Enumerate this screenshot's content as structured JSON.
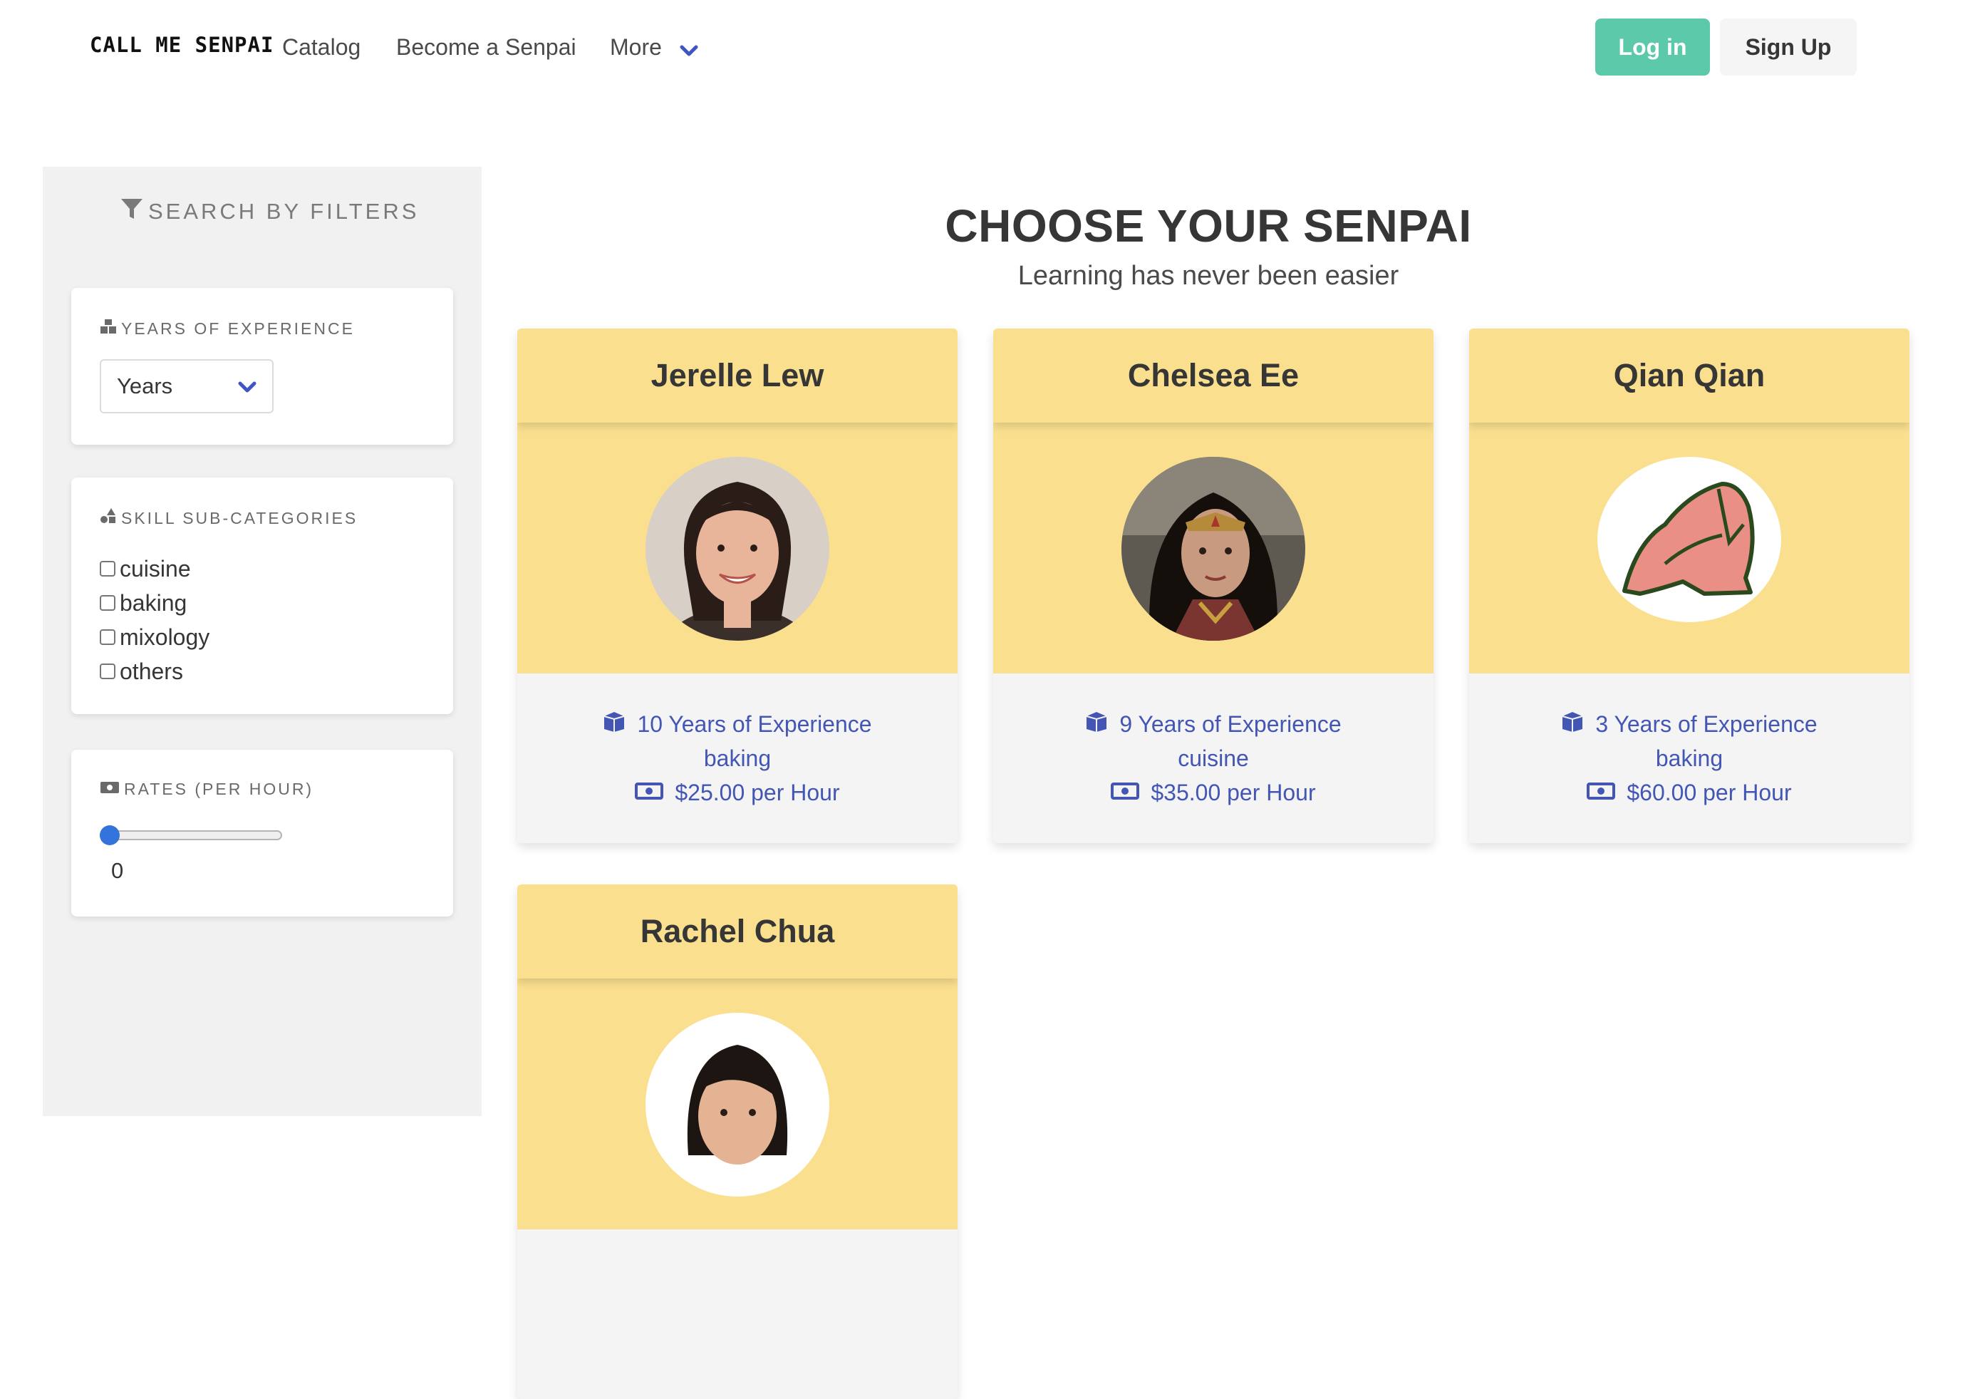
{
  "nav": {
    "brand": "CALL ME SENPAI",
    "links": [
      "Catalog",
      "Become a Senpai",
      "More"
    ],
    "login": "Log in",
    "signup": "Sign Up"
  },
  "sidebar": {
    "title": "SEARCH BY FILTERS",
    "experience": {
      "label": "YEARS OF EXPERIENCE",
      "select_value": "Years"
    },
    "skills": {
      "label": "SKILL SUB-CATEGORIES",
      "options": [
        "cuisine",
        "baking",
        "mixology",
        "others"
      ]
    },
    "rates": {
      "label": "RATES (PER HOUR)",
      "value": "0"
    }
  },
  "main": {
    "heading": "CHOOSE YOUR SENPAI",
    "subheading": "Learning has never been easier",
    "senpais": [
      {
        "name": "Jerelle Lew",
        "experience": "10 Years of Experience",
        "skill": "baking",
        "rate": "$25.00 per Hour"
      },
      {
        "name": "Chelsea Ee",
        "experience": "9 Years of Experience",
        "skill": "cuisine",
        "rate": "$35.00 per Hour"
      },
      {
        "name": "Qian Qian",
        "experience": "3 Years of Experience",
        "skill": "baking",
        "rate": "$60.00 per Hour"
      },
      {
        "name": "Rachel Chua"
      }
    ]
  },
  "colors": {
    "accent": "#5ccaaa",
    "card_header": "#f9df8e",
    "link": "#4456b4",
    "slider": "#3273dc"
  },
  "icons": [
    "filter-icon",
    "cubes-icon",
    "shapes-icon",
    "money-bill-icon",
    "chevron-down-icon"
  ]
}
